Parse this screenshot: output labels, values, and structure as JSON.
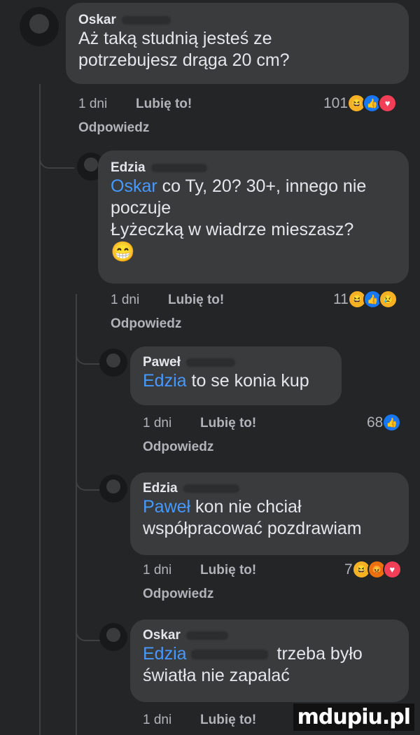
{
  "comments": [
    {
      "author": "Oskar",
      "mention": "",
      "text_line1": "Aż taką studnią jesteś ze",
      "text_line2": "potrzebujesz drąga 20 cm?",
      "age": "1 dni",
      "like_label": "Lubię to!",
      "reaction_count": "101",
      "reply_label": "Odpowiedz",
      "reactions": [
        "haha",
        "like",
        "love"
      ]
    },
    {
      "author": "Edzia",
      "mention": "Oskar",
      "text_line1": " co Ty, 20? 30+, innego nie",
      "text_line2": "poczuje",
      "text_line3": "Łyżeczką w wiadrze mieszasz?",
      "emoji": "😁",
      "age": "1 dni",
      "like_label": "Lubię to!",
      "reaction_count": "11",
      "reply_label": "Odpowiedz",
      "reactions": [
        "haha",
        "like",
        "sad"
      ]
    },
    {
      "author": "Paweł",
      "mention": "Edzia",
      "text_line1": " to se konia kup",
      "age": "1 dni",
      "like_label": "Lubię to!",
      "reaction_count": "68",
      "reply_label": "Odpowiedz",
      "reactions": [
        "like"
      ]
    },
    {
      "author": "Edzia",
      "mention": "Paweł",
      "text_line1": " kon nie chciał",
      "text_line2": "współpracować pozdrawiam",
      "age": "1 dni",
      "like_label": "Lubię to!",
      "reaction_count": "7",
      "reply_label": "Odpowiedz",
      "reactions": [
        "haha",
        "angry",
        "love"
      ]
    },
    {
      "author": "Oskar",
      "mention": "Edzia",
      "text_line1": " trzeba było",
      "text_line2": "światła nie zapalać",
      "age": "1 dni",
      "like_label": "Lubię to!"
    }
  ],
  "watermark": "mdupiu.pl",
  "icons": {
    "like": "👍",
    "love": "♥",
    "haha": "😆",
    "sad": "😢",
    "angry": "😡"
  },
  "colors": {
    "background": "#242526",
    "bubble": "#3a3b3c",
    "mention": "#4599ff",
    "like": "#1877f2",
    "love": "#f33e58"
  }
}
